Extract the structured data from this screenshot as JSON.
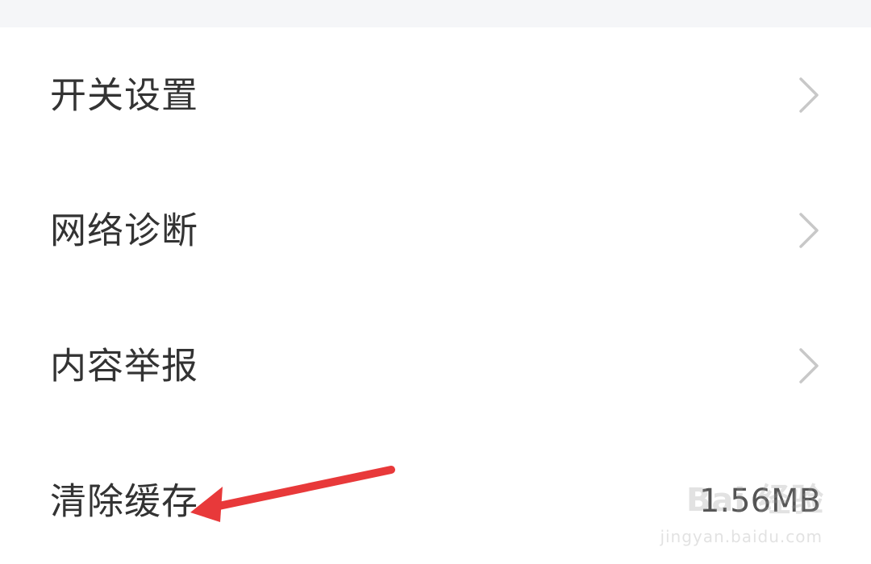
{
  "settings": {
    "items": [
      {
        "label": "开关设置",
        "accessory": "chevron-right-icon"
      },
      {
        "label": "网络诊断",
        "accessory": "chevron-right-icon"
      },
      {
        "label": "内容举报",
        "accessory": "chevron-right-icon"
      },
      {
        "label": "清除缓存",
        "value": "1.56MB"
      }
    ]
  },
  "annotation": {
    "arrow_color": "#e8393a",
    "points_to": "清除缓存"
  },
  "watermark": {
    "logo": "Bai 经验",
    "url": "jingyan.baidu.com"
  },
  "colors": {
    "background": "#ffffff",
    "top_strip": "#f5f6f8",
    "text": "#333333",
    "chevron": "#c8c8c8"
  }
}
